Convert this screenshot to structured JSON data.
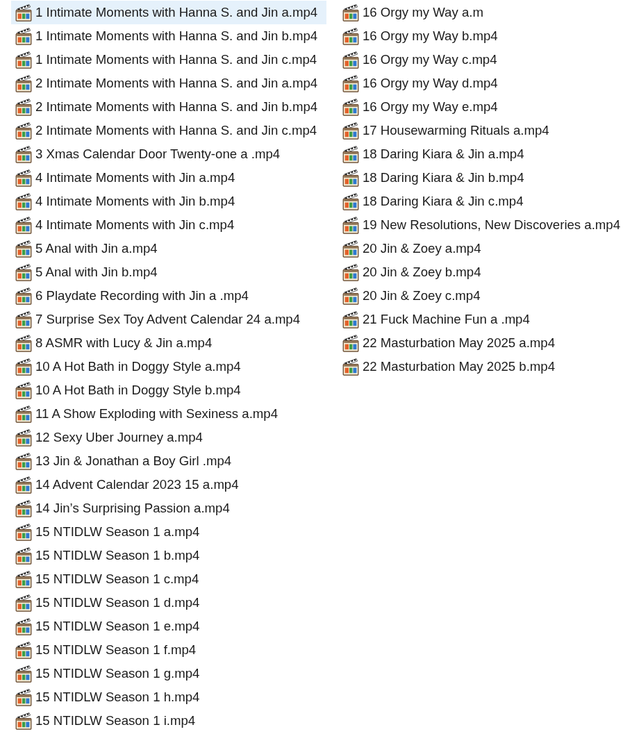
{
  "file_list": {
    "items": [
      {
        "name": "1 Intimate Moments with Hanna S. and Jin a.mp4",
        "selected": true
      },
      {
        "name": "1 Intimate Moments with Hanna S. and Jin b.mp4",
        "selected": false
      },
      {
        "name": "1 Intimate Moments with Hanna S. and Jin c.mp4",
        "selected": false
      },
      {
        "name": "2 Intimate Moments with Hanna S. and Jin a.mp4",
        "selected": false
      },
      {
        "name": "2 Intimate Moments with Hanna S. and Jin b.mp4",
        "selected": false
      },
      {
        "name": "2 Intimate Moments with Hanna S. and Jin c.mp4",
        "selected": false
      },
      {
        "name": "3 Xmas Calendar Door Twenty-one a .mp4",
        "selected": false
      },
      {
        "name": "4 Intimate Moments with Jin a.mp4",
        "selected": false
      },
      {
        "name": "4 Intimate Moments with Jin b.mp4",
        "selected": false
      },
      {
        "name": "4 Intimate Moments with Jin c.mp4",
        "selected": false
      },
      {
        "name": "5 Anal with Jin a.mp4",
        "selected": false
      },
      {
        "name": "5 Anal with Jin b.mp4",
        "selected": false
      },
      {
        "name": "6 Playdate Recording with Jin a .mp4",
        "selected": false
      },
      {
        "name": "7 Surprise Sex Toy Advent Calendar 24 a.mp4",
        "selected": false
      },
      {
        "name": "8 ASMR with Lucy & Jin a.mp4",
        "selected": false
      },
      {
        "name": "10 A Hot Bath in Doggy Style a.mp4",
        "selected": false
      },
      {
        "name": "10 A Hot Bath in Doggy Style b.mp4",
        "selected": false
      },
      {
        "name": "11 A Show Exploding with Sexiness a.mp4",
        "selected": false
      },
      {
        "name": "12 Sexy Uber Journey a.mp4",
        "selected": false
      },
      {
        "name": "13 Jin & Jonathan a Boy Girl .mp4",
        "selected": false
      },
      {
        "name": "14 Advent Calendar 2023 15 a.mp4",
        "selected": false
      },
      {
        "name": "14 Jin’s Surprising Passion a.mp4",
        "selected": false
      },
      {
        "name": "15 NTIDLW Season 1 a.mp4",
        "selected": false
      },
      {
        "name": "15 NTIDLW Season 1 b.mp4",
        "selected": false
      },
      {
        "name": "15 NTIDLW Season 1 c.mp4",
        "selected": false
      },
      {
        "name": "15 NTIDLW Season 1 d.mp4",
        "selected": false
      },
      {
        "name": "15 NTIDLW Season 1 e.mp4",
        "selected": false
      },
      {
        "name": "15 NTIDLW Season 1 f.mp4",
        "selected": false
      },
      {
        "name": "15 NTIDLW Season 1 g.mp4",
        "selected": false
      },
      {
        "name": "15 NTIDLW Season 1 h.mp4",
        "selected": false
      },
      {
        "name": "15 NTIDLW Season 1 i.mp4",
        "selected": false
      },
      {
        "name": "16 Orgy my Way a.m",
        "selected": false
      },
      {
        "name": "16 Orgy my Way b.mp4",
        "selected": false
      },
      {
        "name": "16 Orgy my Way c.mp4",
        "selected": false
      },
      {
        "name": "16 Orgy my Way d.mp4",
        "selected": false
      },
      {
        "name": "16 Orgy my Way e.mp4",
        "selected": false
      },
      {
        "name": "17 Housewarming Rituals a.mp4",
        "selected": false
      },
      {
        "name": "18 Daring Kiara & Jin a.mp4",
        "selected": false
      },
      {
        "name": "18 Daring Kiara & Jin b.mp4",
        "selected": false
      },
      {
        "name": "18 Daring Kiara & Jin c.mp4",
        "selected": false
      },
      {
        "name": "19 New Resolutions, New Discoveries a.mp4",
        "selected": false
      },
      {
        "name": "20 Jin & Zoey a.mp4",
        "selected": false
      },
      {
        "name": "20 Jin & Zoey b.mp4",
        "selected": false
      },
      {
        "name": "20 Jin & Zoey c.mp4",
        "selected": false
      },
      {
        "name": "21 Fuck Machine Fun a .mp4",
        "selected": false
      },
      {
        "name": "22 Masturbation May 2025 a.mp4",
        "selected": false
      },
      {
        "name": "22 Masturbation May 2025 b.mp4",
        "selected": false
      }
    ]
  }
}
